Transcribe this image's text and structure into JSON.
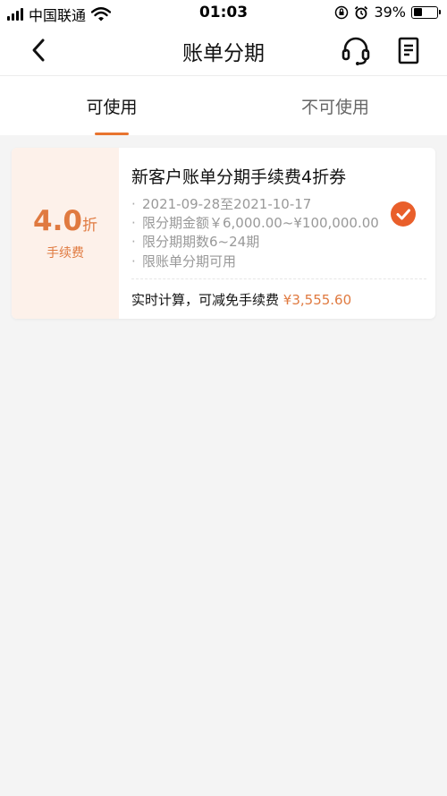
{
  "status_bar": {
    "carrier": "中国联通",
    "time": "01:03",
    "battery": "39%",
    "battery_level": 0.39
  },
  "nav": {
    "title": "账单分期",
    "back_icon": "chevron-left-icon",
    "service_icon": "headset-icon",
    "bill_icon": "receipt-icon"
  },
  "tabs": [
    {
      "label": "可使用",
      "active": true
    },
    {
      "label": "不可使用",
      "active": false
    }
  ],
  "coupon": {
    "discount_value": "4.0",
    "discount_unit": "折",
    "discount_label": "手续费",
    "title": "新客户账单分期手续费4折券",
    "conditions": [
      "2021-09-28至2021-10-17",
      "限分期金额￥6,000.00~¥100,000.00",
      "限分期期数6~24期",
      "限账单分期可用"
    ],
    "saving_prefix": "实时计算，可减免手续费",
    "saving_amount": "¥3,555.60",
    "selected": true
  },
  "colors": {
    "accent": "#e8742f",
    "check": "#e95f2b",
    "coupon_left_bg": "#fdf1ea"
  }
}
